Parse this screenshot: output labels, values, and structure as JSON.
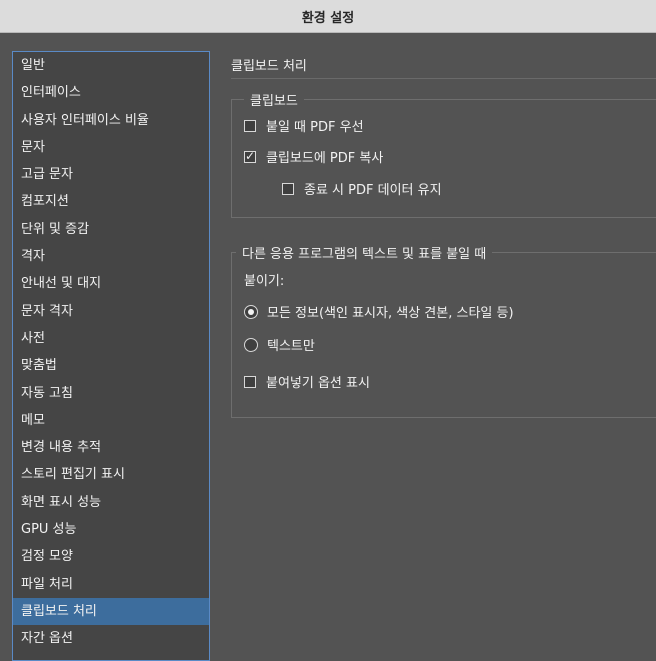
{
  "window": {
    "title": "환경 설정"
  },
  "sidebar": {
    "items": [
      {
        "label": "일반"
      },
      {
        "label": "인터페이스"
      },
      {
        "label": "사용자 인터페이스 비율"
      },
      {
        "label": "문자"
      },
      {
        "label": "고급 문자"
      },
      {
        "label": "컴포지션"
      },
      {
        "label": "단위 및 증감"
      },
      {
        "label": "격자"
      },
      {
        "label": "안내선 및 대지"
      },
      {
        "label": "문자 격자"
      },
      {
        "label": "사전"
      },
      {
        "label": "맞춤법"
      },
      {
        "label": "자동 고침"
      },
      {
        "label": "메모"
      },
      {
        "label": "변경 내용 추적"
      },
      {
        "label": "스토리 편집기 표시"
      },
      {
        "label": "화면 표시 성능"
      },
      {
        "label": "GPU 성능"
      },
      {
        "label": "검정 모양"
      },
      {
        "label": "파일 처리"
      },
      {
        "label": "클립보드 처리",
        "selected": true
      },
      {
        "label": "자간 옵션"
      }
    ]
  },
  "panel": {
    "title": "클립보드 처리",
    "clipboard_group": {
      "legend": "클립보드",
      "prefer_pdf_paste": {
        "label": "붙일 때 PDF 우선",
        "checked": false
      },
      "copy_pdf_to_clipboard": {
        "label": "클립보드에 PDF 복사",
        "checked": true
      },
      "keep_pdf_on_exit": {
        "label": "종료 시 PDF 데이터 유지",
        "checked": false
      }
    },
    "paste_group": {
      "legend": "다른 응용 프로그램의 텍스트 및 표를 붙일 때",
      "paste_label": "붙이기:",
      "all_info": {
        "label": "모든 정보(색인 표시자, 색상 견본, 스타일 등)",
        "selected": true
      },
      "text_only": {
        "label": "텍스트만",
        "selected": false
      },
      "show_paste_options": {
        "label": "붙여넣기 옵션 표시",
        "checked": false
      }
    }
  },
  "colors": {
    "background": "#535353",
    "sidebar_bg": "#454545",
    "selection": "#3d6d9d",
    "sidebar_border": "#5a8ac6",
    "titlebar": "#dcdcdc"
  }
}
